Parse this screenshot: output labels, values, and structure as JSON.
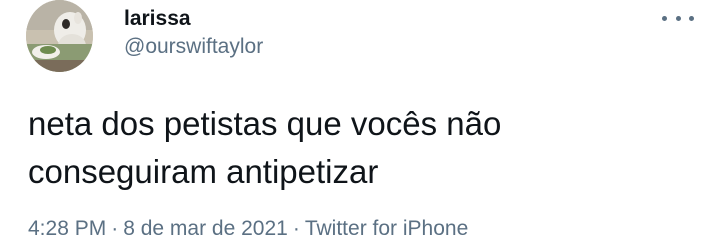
{
  "author": {
    "display_name": "larissa",
    "handle": "@ourswiftaylor"
  },
  "tweet": {
    "text_lines": [
      "neta dos petistas que vocês não",
      "conseguiram antipetizar"
    ]
  },
  "meta": {
    "time": "4:28 PM",
    "separator": "·",
    "date": "8 de mar de 2021",
    "source": "Twitter for iPhone"
  },
  "icons": {
    "more": "more-horizontal-icon"
  },
  "colors": {
    "text_primary": "#0f1419",
    "text_secondary": "#5b7083",
    "background": "#ffffff"
  }
}
